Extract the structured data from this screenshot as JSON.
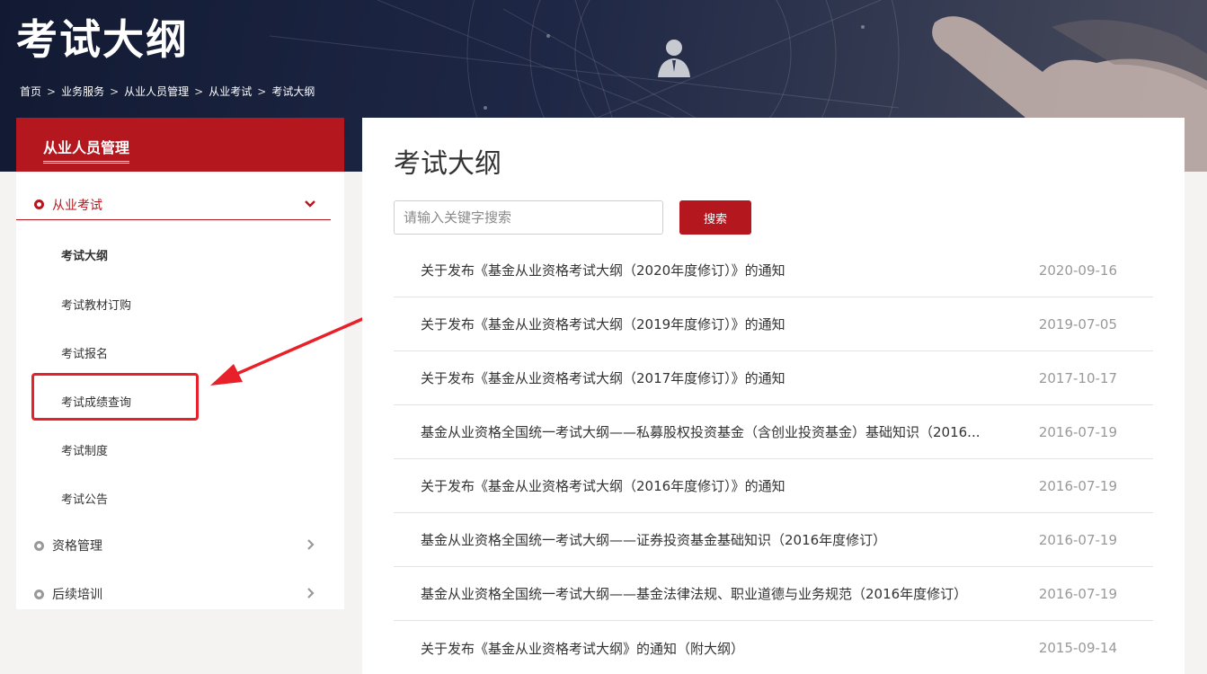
{
  "banner": {
    "title": "考试大纲",
    "breadcrumb": [
      "首页",
      "业务服务",
      "从业人员管理",
      "从业考试",
      "考试大纲"
    ],
    "separator": ">"
  },
  "sidebar": {
    "title": "从业人员管理",
    "groups": [
      {
        "label": "从业考试",
        "expanded": true,
        "items": [
          "考试大纲",
          "考试教材订购",
          "考试报名",
          "考试成绩查询",
          "考试制度",
          "考试公告"
        ],
        "current": "考试大纲"
      },
      {
        "label": "资格管理",
        "expanded": false
      },
      {
        "label": "后续培训",
        "expanded": false
      }
    ],
    "highlighted_item": "考试成绩查询"
  },
  "main": {
    "title": "考试大纲",
    "search": {
      "placeholder": "请输入关键字搜索",
      "value": "",
      "button_label": "搜索"
    },
    "items": [
      {
        "title": "关于发布《基金从业资格考试大纲（2020年度修订）》的通知",
        "date": "2020-09-16"
      },
      {
        "title": "关于发布《基金从业资格考试大纲（2019年度修订）》的通知",
        "date": "2019-07-05"
      },
      {
        "title": "关于发布《基金从业资格考试大纲（2017年度修订）》的通知",
        "date": "2017-10-17"
      },
      {
        "title": "基金从业资格全国统一考试大纲——私募股权投资基金（含创业投资基金）基础知识（2016...",
        "date": "2016-07-19"
      },
      {
        "title": "关于发布《基金从业资格考试大纲（2016年度修订）》的通知",
        "date": "2016-07-19"
      },
      {
        "title": "基金从业资格全国统一考试大纲——证券投资基金基础知识（2016年度修订）",
        "date": "2016-07-19"
      },
      {
        "title": "基金从业资格全国统一考试大纲——基金法律法规、职业道德与业务规范（2016年度修订）",
        "date": "2016-07-19"
      },
      {
        "title": "关于发布《基金从业资格考试大纲》的通知（附大纲）",
        "date": "2015-09-14"
      }
    ]
  },
  "colors": {
    "accent": "#b5171f",
    "annotation": "#e8202a",
    "banner_dark": "#1e2745"
  },
  "icons": [
    "person-icon",
    "chevron-down-icon",
    "chevron-right-icon",
    "radio-dot-icon",
    "arrow-annotation"
  ]
}
